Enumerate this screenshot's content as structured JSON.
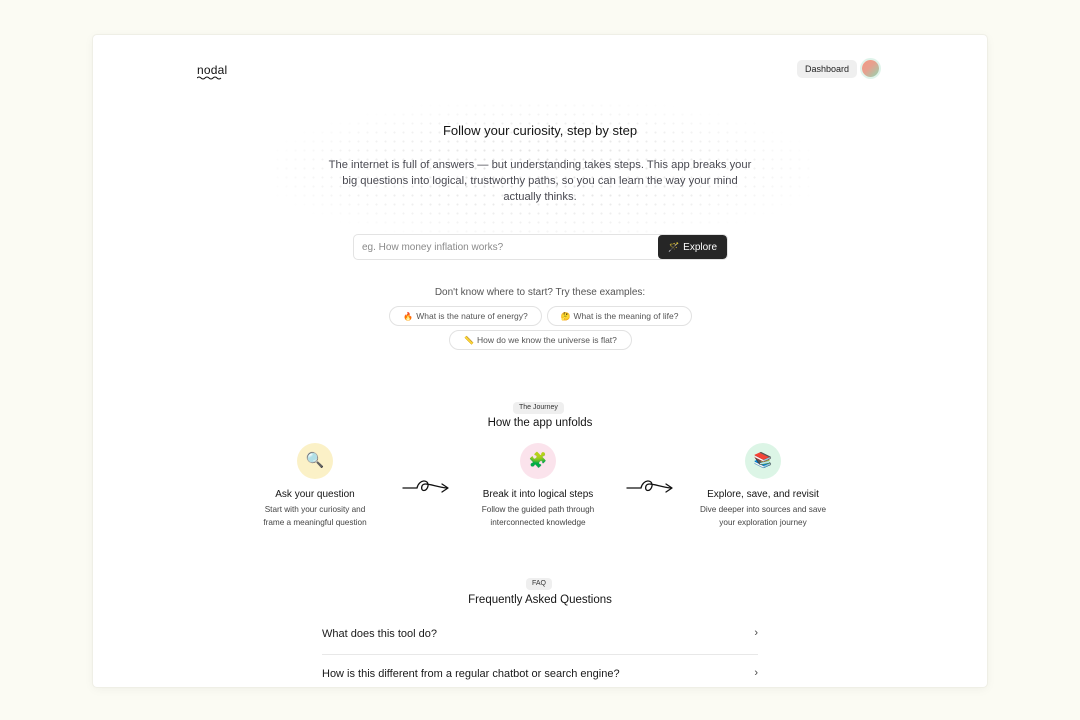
{
  "app": {
    "logo": "nodal"
  },
  "header": {
    "dashboard_label": "Dashboard"
  },
  "hero": {
    "title": "Follow your curiosity, step by step",
    "description": "The internet is full of answers — but understanding takes steps. This app breaks your big questions into logical, trustworthy paths, so you can learn the way your mind actually thinks."
  },
  "search": {
    "placeholder": "eg. How money inflation works?",
    "value": "",
    "button_label": "Explore",
    "button_icon": "magic-wand-icon"
  },
  "examples": {
    "label": "Don't know where to start? Try these examples:",
    "items": [
      {
        "emoji": "🔥",
        "text": "What is the nature of energy?"
      },
      {
        "emoji": "🤔",
        "text": "What is the meaning of life?"
      },
      {
        "emoji": "📏",
        "text": "How do we know the universe is flat?"
      }
    ]
  },
  "journey": {
    "badge": "The Journey",
    "title": "How the app unfolds",
    "steps": [
      {
        "icon": "🔍",
        "title": "Ask your question",
        "desc_line1": "Start with your curiosity and",
        "desc_line2": "frame a meaningful question",
        "icon_bg": "#fbf1c7"
      },
      {
        "icon": "🧩",
        "title": "Break it into logical steps",
        "desc_line1": "Follow the guided path through",
        "desc_line2": "interconnected knowledge",
        "icon_bg": "#fbe3ec"
      },
      {
        "icon": "📚",
        "title": "Explore, save, and revisit",
        "desc_line1": "Dive deeper into sources and save",
        "desc_line2": "your exploration journey",
        "icon_bg": "#dcf5e6"
      }
    ]
  },
  "faq": {
    "badge": "FAQ",
    "title": "Frequently Asked Questions",
    "items": [
      {
        "question": "What does this tool do?",
        "chevron": "›"
      },
      {
        "question": "How is this different from a regular chatbot or search engine?",
        "chevron": "›"
      }
    ]
  },
  "colors": {
    "page_bg": "#fbfbf3",
    "accent_dark": "#262626"
  }
}
